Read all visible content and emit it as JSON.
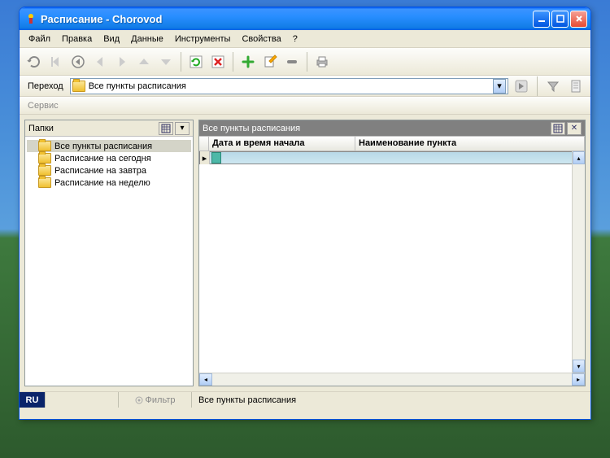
{
  "title": "Расписание - Chorovod",
  "menu": [
    "Файл",
    "Правка",
    "Вид",
    "Данные",
    "Инструменты",
    "Свойства",
    "?"
  ],
  "addressbar": {
    "label": "Переход",
    "value": "Все пункты расписания"
  },
  "servicebar": "Сервис",
  "left_panel": {
    "title": "Папки",
    "items": [
      "Все пункты расписания",
      "Расписание на сегодня",
      "Расписание на завтра",
      "Расписание на неделю"
    ]
  },
  "right_panel": {
    "title": "Все пункты расписания",
    "columns": [
      "Дата и время начала",
      "Наименование пункта"
    ]
  },
  "statusbar": {
    "lang": "RU",
    "filter": "Фильтр",
    "message": "Все пункты расписания"
  }
}
